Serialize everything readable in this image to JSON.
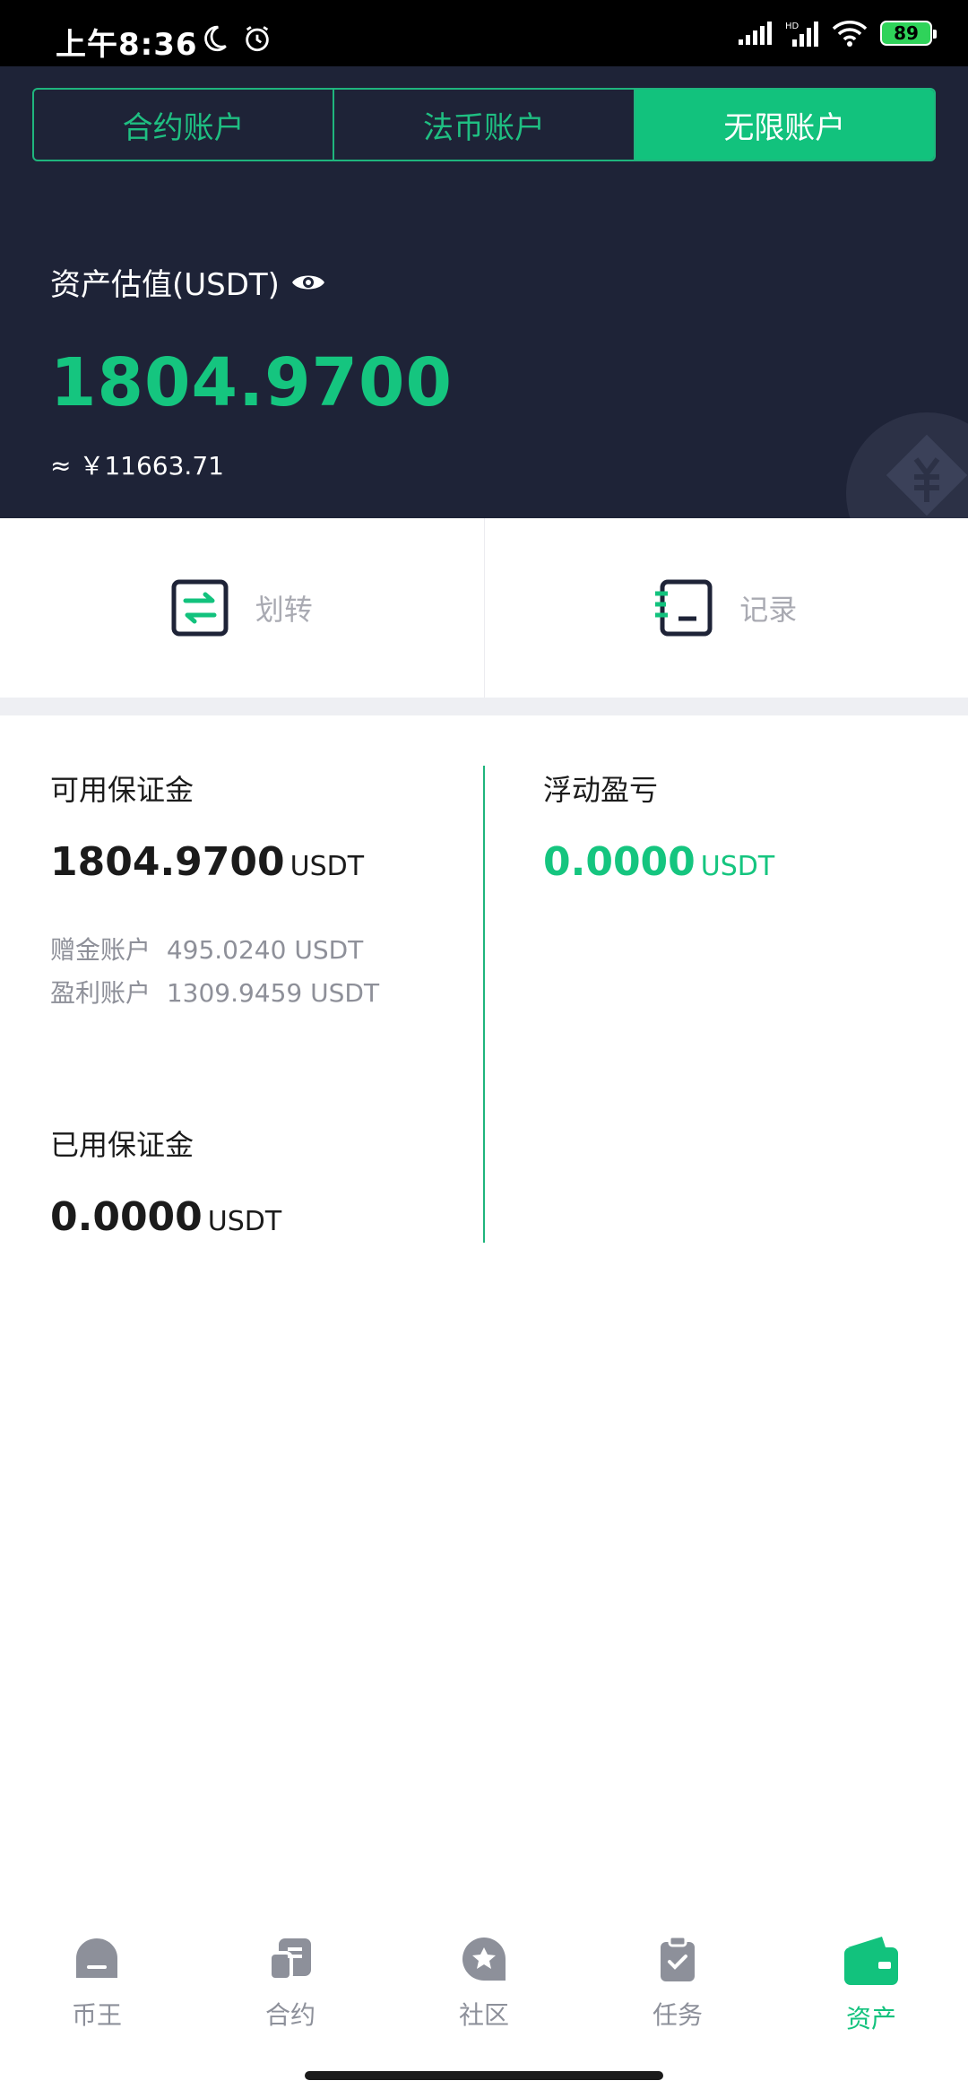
{
  "status": {
    "time": "上午8:36",
    "battery": "89"
  },
  "tabs": [
    "合约账户",
    "法币账户",
    "无限账户"
  ],
  "asset": {
    "label": "资产估值(USDT)",
    "value": "1804.9700",
    "approx": "≈ ￥11663.71"
  },
  "actions": {
    "transfer": "划转",
    "records": "记录"
  },
  "margin": {
    "available_title": "可用保证金",
    "available_value": "1804.9700",
    "unit": "USDT",
    "bonus_label": "赠金账户",
    "bonus_value": "495.0240 USDT",
    "profit_label": "盈利账户",
    "profit_value": "1309.9459 USDT",
    "used_title": "已用保证金",
    "used_value": "0.0000",
    "floating_title": "浮动盈亏",
    "floating_value": "0.0000"
  },
  "nav": [
    "币王",
    "合约",
    "社区",
    "任务",
    "资产"
  ],
  "colors": {
    "accent": "#12c27d",
    "header_bg": "#1e2337"
  }
}
